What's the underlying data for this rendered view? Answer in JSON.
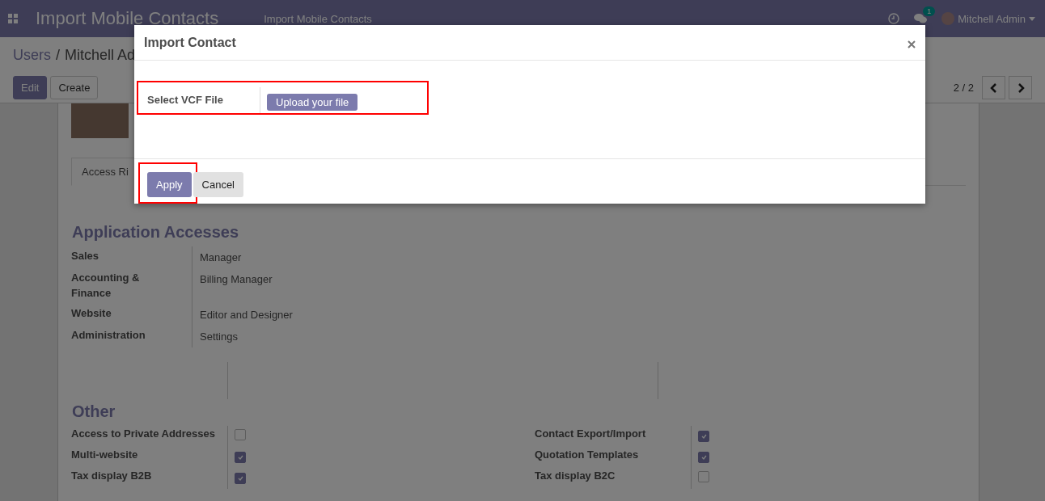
{
  "navbar": {
    "brand": "Import Mobile Contacts",
    "menu": [
      "Import Mobile Contacts"
    ],
    "notification_count": "1",
    "user": "Mitchell Admin"
  },
  "breadcrumb": [
    "Users",
    "Mitchell Ad"
  ],
  "breadcrumb_separator": "/",
  "actions": [
    {
      "label": "Edit",
      "primary": true
    },
    {
      "label": "Create",
      "primary": false
    }
  ],
  "pager": "2 / 2",
  "tabs": [
    {
      "label": "Access Ri",
      "selected": true
    }
  ],
  "access_section": {
    "title": "Application Accesses",
    "rows": [
      {
        "label": "Sales",
        "value": "Manager"
      },
      {
        "label": "Accounting & Finance",
        "value": "Billing Manager"
      },
      {
        "label": "Website",
        "value": "Editor and Designer"
      },
      {
        "label": "Administration",
        "value": "Settings"
      }
    ]
  },
  "other_section": {
    "title": "Other",
    "columns": [
      [
        {
          "label": "Access to Private Addresses",
          "checked": false
        },
        {
          "label": "Multi-website",
          "checked": true
        },
        {
          "label": "Tax display B2B",
          "checked": true
        }
      ],
      [
        {
          "label": "Contact Export/Import",
          "checked": true
        },
        {
          "label": "Quotation Templates",
          "checked": true
        },
        {
          "label": "Tax display B2C",
          "checked": false
        }
      ]
    ]
  },
  "dialog": {
    "title": "Import Contact",
    "field": {
      "label": "Select VCF File",
      "button": "Upload your file",
      "highlighted": true
    },
    "buttons": [
      {
        "label": "Apply",
        "primary": true,
        "highlighted": true
      },
      {
        "label": "Cancel",
        "primary": false,
        "highlighted": false
      }
    ]
  }
}
